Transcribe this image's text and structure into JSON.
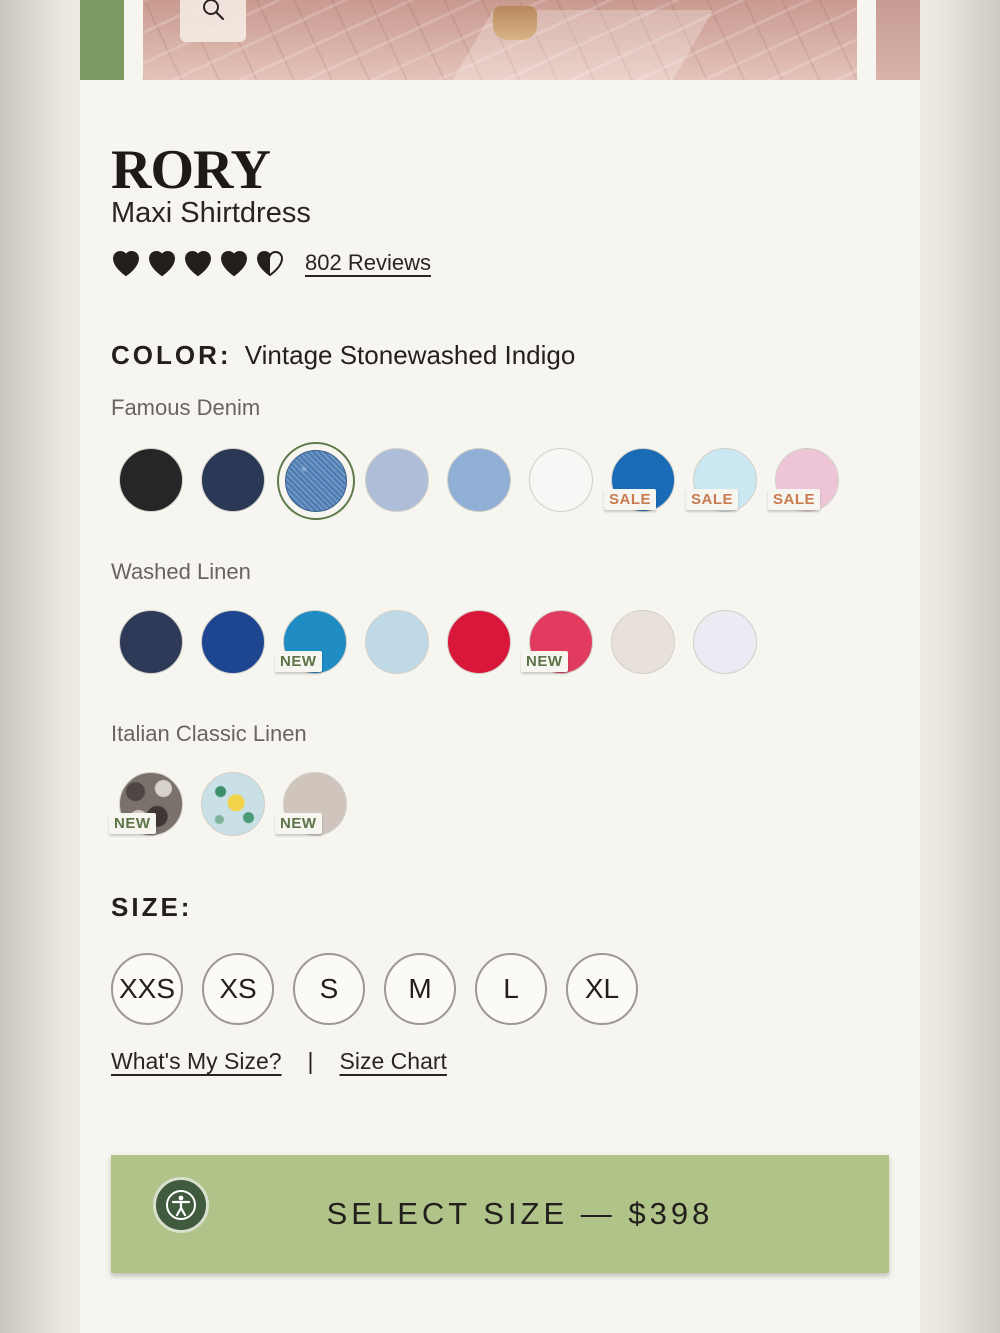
{
  "product": {
    "name": "RORY",
    "subtitle": "Maxi Shirtdress",
    "rating": 4.5,
    "reviews_label": "802 Reviews"
  },
  "color": {
    "label": "COLOR:",
    "selected": "Vintage Stonewashed Indigo"
  },
  "groups": [
    {
      "title": "Famous Denim",
      "swatches": [
        {
          "color": "#262626",
          "badge": ""
        },
        {
          "color": "#2a3856",
          "badge": ""
        },
        {
          "color": "#4b79b0",
          "badge": "",
          "selected": true
        },
        {
          "color": "#aebed9",
          "badge": ""
        },
        {
          "color": "#8fb0d4",
          "badge": ""
        },
        {
          "color": "#f7f7f5",
          "badge": ""
        },
        {
          "color": "#1a6bb5",
          "badge": "SALE"
        },
        {
          "color": "#cbe7f2",
          "badge": "SALE"
        },
        {
          "color": "#eec5d6",
          "badge": "SALE"
        }
      ]
    },
    {
      "title": "Washed Linen",
      "swatches": [
        {
          "color": "#2f3a58",
          "badge": ""
        },
        {
          "color": "#1d4590",
          "badge": ""
        },
        {
          "color": "#1f8cc4",
          "badge": "NEW"
        },
        {
          "color": "#c0d9e6",
          "badge": ""
        },
        {
          "color": "#d8173a",
          "badge": ""
        },
        {
          "color": "#e13b5f",
          "badge": "NEW"
        },
        {
          "color": "#e7e1d9",
          "badge": ""
        },
        {
          "color": "#eceaf2",
          "badge": ""
        }
      ]
    },
    {
      "title": "Italian Classic Linen",
      "swatches": [
        {
          "color": "#7b716c",
          "badge": "NEW",
          "pattern": "camo"
        },
        {
          "color": "#c9e0e6",
          "badge": "",
          "pattern": "floral"
        },
        {
          "color": "#cfc5bd",
          "badge": "NEW"
        }
      ]
    }
  ],
  "size": {
    "label": "SIZE:",
    "options": [
      "XXS",
      "XS",
      "S",
      "M",
      "L",
      "XL"
    ],
    "whats_my_size": "What's My Size?",
    "separator": "|",
    "size_chart": "Size Chart"
  },
  "cta": {
    "label": "SELECT SIZE — $398"
  },
  "icons": {
    "zoom": "magnifier-icon",
    "accessibility": "accessibility-icon",
    "rating": "heart-icon"
  },
  "colors": {
    "background": "#f6f5ef",
    "accent_green": "#b0c388",
    "selected_ring": "#5f7a4a",
    "sale_text": "#c97b52",
    "new_text": "#5c7448"
  }
}
